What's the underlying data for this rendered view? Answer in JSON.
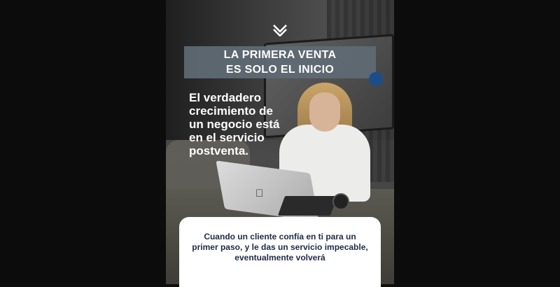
{
  "post": {
    "logo_icon": "brand-chevron-m-logo",
    "banner": {
      "line1": "LA PRIMERA VENTA",
      "line2": "ES SOLO EL INICIO",
      "background": "#5f6a74"
    },
    "accent_dot_color": "#1c4d8a",
    "headline_lines": [
      "El verdadero",
      "crecimiento de",
      "un negocio está",
      "en el servicio",
      "postventa."
    ],
    "card_lines": [
      "Cuando un cliente confía en ti para un",
      "primer paso, y le das un servicio impecable,",
      "eventualmente volverá"
    ],
    "text_color_dark": "#1f2a44"
  }
}
